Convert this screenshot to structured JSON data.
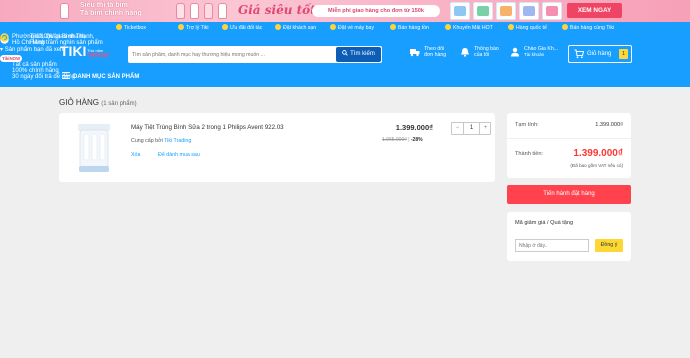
{
  "promo": {
    "line1": "Siêu thị tã bỉm",
    "line2": "Tã bỉm chính hãng",
    "script": "Giá siêu tốt",
    "pill": "Miễn phí giao hàng cho đơn từ 150k",
    "cta": "XEM NGAY"
  },
  "toplinks": [
    {
      "label": "Ticketbox"
    },
    {
      "label": "Trợ lý Tiki"
    },
    {
      "label": "Ưu đãi đối tác"
    },
    {
      "label": "Đặt khách sạn"
    },
    {
      "label": "Đặt vé máy bay"
    },
    {
      "label": "Bán hàng tồn"
    },
    {
      "label": "Khuyến Mãi HOT"
    },
    {
      "label": "Hàng quốc tế"
    },
    {
      "label": "Bán hàng cùng Tiki"
    }
  ],
  "header": {
    "logo": "TIKI",
    "now_top": "Thứ năm",
    "now_brand": "TIKINOW",
    "search_placeholder": "Tìm sản phẩm, danh mục hay thương hiệu mong muốn ...",
    "search_button": "Tìm kiếm",
    "orders_l1": "Theo dõi",
    "orders_l2": "đơn hàng",
    "notif_l1": "Thông báo",
    "notif_l2": "của tôi",
    "account_l1": "Chào Gia Kh...",
    "account_l2": "Tài khoản",
    "cart_label": "Giỏ hàng",
    "cart_count": "1"
  },
  "subnav": {
    "category_menu": "DANH MỤC SẢN PHẨM",
    "address_l1": "Phường 12, Quận Bình Thạnh,",
    "address_l2": "Hồ Chí Minh",
    "viewed": "Sản phẩm bạn đã xem",
    "now_badge": "TikiNOW",
    "now_l1": "TikiNOW giao nhanh",
    "now_l2": "Hàng trăm nghìn sản phẩm",
    "genuine_l1": "Tất cả sản phẩm",
    "genuine_l2": "100% chính hãng",
    "returns": "30 ngày đổi trả dễ dàng"
  },
  "cart": {
    "title": "GIỎ HÀNG",
    "count_text": "(1 sản phẩm)",
    "item": {
      "name": "Máy Tiệt Trùng Bình Sữa 2 trong 1 Philips Avent 922.03",
      "seller_prefix": "Cung cấp bởi",
      "seller": "Tiki Trading",
      "remove": "Xóa",
      "save_later": "Để dành mua sau",
      "price": "1.399.000₫",
      "old_price": "1.965.000₫",
      "discount": "-28%",
      "qty_minus": "−",
      "qty": "1",
      "qty_plus": "+"
    }
  },
  "summary": {
    "subtotal_label": "Tạm tính:",
    "subtotal": "1.399.000₫",
    "total_label": "Thành tiền:",
    "total": "1.399.000₫",
    "vat_note": "(Đã bao gồm VAT nếu có)",
    "checkout": "Tiến hành đặt hàng"
  },
  "coupon": {
    "title": "Mã giảm giá / Quà tặng",
    "placeholder": "Nhập ở đây..",
    "apply": "Đồng ý"
  }
}
